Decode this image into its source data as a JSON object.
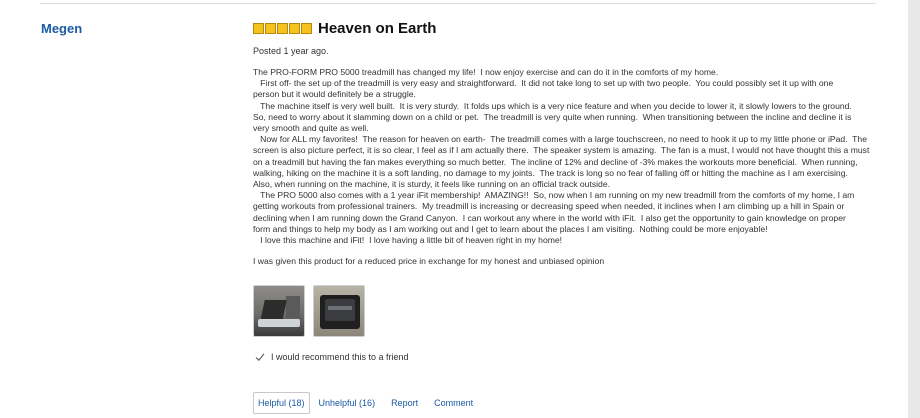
{
  "review": {
    "reviewer": "Megen",
    "rating": 5,
    "title": "Heaven on Earth",
    "posted": "Posted 1 year ago.",
    "body": "The PRO-FORM PRO 5000 treadmill has changed my life!  I now enjoy exercise and can do it in the comforts of my home.\n   First off- the set up of the treadmill is very easy and straightforward.  It did not take long to set up with two people.  You could possibly set it up with one\nperson but it would definitely be a struggle.\n   The machine itself is very well built.  It is very sturdy.  It folds ups which is a very nice feature and when you decide to lower it, it slowly lowers to the ground.\nSo, need to worry about it slamming down on a child or pet.  The treadmill is very quite when running.  When transitioning between the incline and decline it is\nvery smooth and quite as well.\n   Now for ALL my favorites!  The reason for heaven on earth-  The treadmill comes with a large touchscreen, no need to hook it up to my little phone or iPad.  The\nscreen is also picture perfect, it is so clear, I feel as if I am actually there.  The speaker system is amazing.  The fan is a must, I would not have thought this a must\non a treadmill but having the fan makes everything so much better.  The incline of 12% and decline of -3% makes the workouts more beneficial.  When running,\nwalking, hiking on the machine it is a soft landing, no damage to my joints.  The track is long so no fear of falling off or hitting the machine as I am exercising.\nAlso, when running on the machine, it is sturdy, it feels like running on an official track outside.\n   The PRO 5000 also comes with a 1 year iFit membership!  AMAZING!!  So, now when I am running on my new treadmill from the comforts of my home, I am\ngetting workouts from professional trainers.  My treadmill is increasing or decreasing speed when needed, it inclines when I am climbing up a hill in Spain or\ndeclining when I am running down the Grand Canyon.  I can workout any where in the world with iFit.  I also get the opportunity to gain knowledge on proper\nform and things to help my body as I am working out and I get to learn about the places I am visiting.  Nothing could be more enjoyable!\n   I love this machine and iFit!  I love having a little bit of heaven right in my home!",
    "disclaimer": "I was given this product for a reduced price in exchange for my honest and unbiased opinion",
    "recommend": "I would recommend this to a friend"
  },
  "actions": {
    "helpful": "Helpful (18)",
    "unhelpful": "Unhelpful (16)",
    "report": "Report",
    "comment": "Comment"
  },
  "colors": {
    "link": "#1a5aa6",
    "star": "#f6c21c"
  },
  "icons": {
    "star": "star-icon",
    "check": "check-icon"
  }
}
